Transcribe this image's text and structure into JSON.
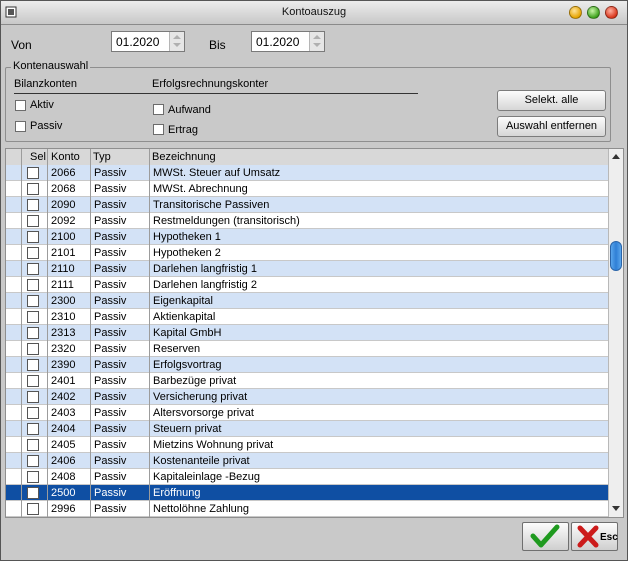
{
  "window": {
    "title": "Kontoauszug"
  },
  "dates": {
    "from_label": "Von",
    "from_value": "01.2020",
    "to_label": "Bis",
    "to_value": "01.2020"
  },
  "group": {
    "legend": "Kontenauswahl",
    "bilanz_header": "Bilanzkonten",
    "erfolg_header": "Erfolgsrechnungskonter",
    "aktiv": "Aktiv",
    "passiv": "Passiv",
    "aufwand": "Aufwand",
    "ertrag": "Ertrag",
    "select_all": "Selekt. alle",
    "remove_selection": "Auswahl entfernen"
  },
  "table": {
    "headers": {
      "sel": "Sel",
      "konto": "Konto",
      "typ": "Typ",
      "bez": "Bezeichnung"
    },
    "rows": [
      {
        "konto": "2066",
        "typ": "Passiv",
        "bez": "MWSt. Steuer auf Umsatz"
      },
      {
        "konto": "2068",
        "typ": "Passiv",
        "bez": "MWSt. Abrechnung"
      },
      {
        "konto": "2090",
        "typ": "Passiv",
        "bez": "Transitorische Passiven"
      },
      {
        "konto": "2092",
        "typ": "Passiv",
        "bez": "Restmeldungen (transitorisch)"
      },
      {
        "konto": "2100",
        "typ": "Passiv",
        "bez": "Hypotheken 1"
      },
      {
        "konto": "2101",
        "typ": "Passiv",
        "bez": "Hypotheken 2"
      },
      {
        "konto": "2110",
        "typ": "Passiv",
        "bez": "Darlehen langfristig 1"
      },
      {
        "konto": "2111",
        "typ": "Passiv",
        "bez": "Darlehen langfristig 2"
      },
      {
        "konto": "2300",
        "typ": "Passiv",
        "bez": "Eigenkapital"
      },
      {
        "konto": "2310",
        "typ": "Passiv",
        "bez": "Aktienkapital"
      },
      {
        "konto": "2313",
        "typ": "Passiv",
        "bez": "Kapital GmbH"
      },
      {
        "konto": "2320",
        "typ": "Passiv",
        "bez": "Reserven"
      },
      {
        "konto": "2390",
        "typ": "Passiv",
        "bez": "Erfolgsvortrag"
      },
      {
        "konto": "2401",
        "typ": "Passiv",
        "bez": "Barbezüge privat"
      },
      {
        "konto": "2402",
        "typ": "Passiv",
        "bez": "Versicherung privat"
      },
      {
        "konto": "2403",
        "typ": "Passiv",
        "bez": "Altersvorsorge privat"
      },
      {
        "konto": "2404",
        "typ": "Passiv",
        "bez": "Steuern privat"
      },
      {
        "konto": "2405",
        "typ": "Passiv",
        "bez": "Mietzins Wohnung privat"
      },
      {
        "konto": "2406",
        "typ": "Passiv",
        "bez": "Kostenanteile privat"
      },
      {
        "konto": "2408",
        "typ": "Passiv",
        "bez": "Kapitaleinlage -Bezug"
      },
      {
        "konto": "2500",
        "typ": "Passiv",
        "bez": "Eröffnung",
        "selected": true
      },
      {
        "konto": "2996",
        "typ": "Passiv",
        "bez": "Nettolöhne Zahlung"
      }
    ]
  },
  "footer": {
    "ok_icon": "green-checkmark-icon",
    "esc_label": "Esc",
    "esc_icon": "red-x-icon"
  },
  "colors": {
    "selected_row": "#0f4fa3",
    "alt_row": "#d3e2f6",
    "window_bg": "#c9c9c9"
  }
}
